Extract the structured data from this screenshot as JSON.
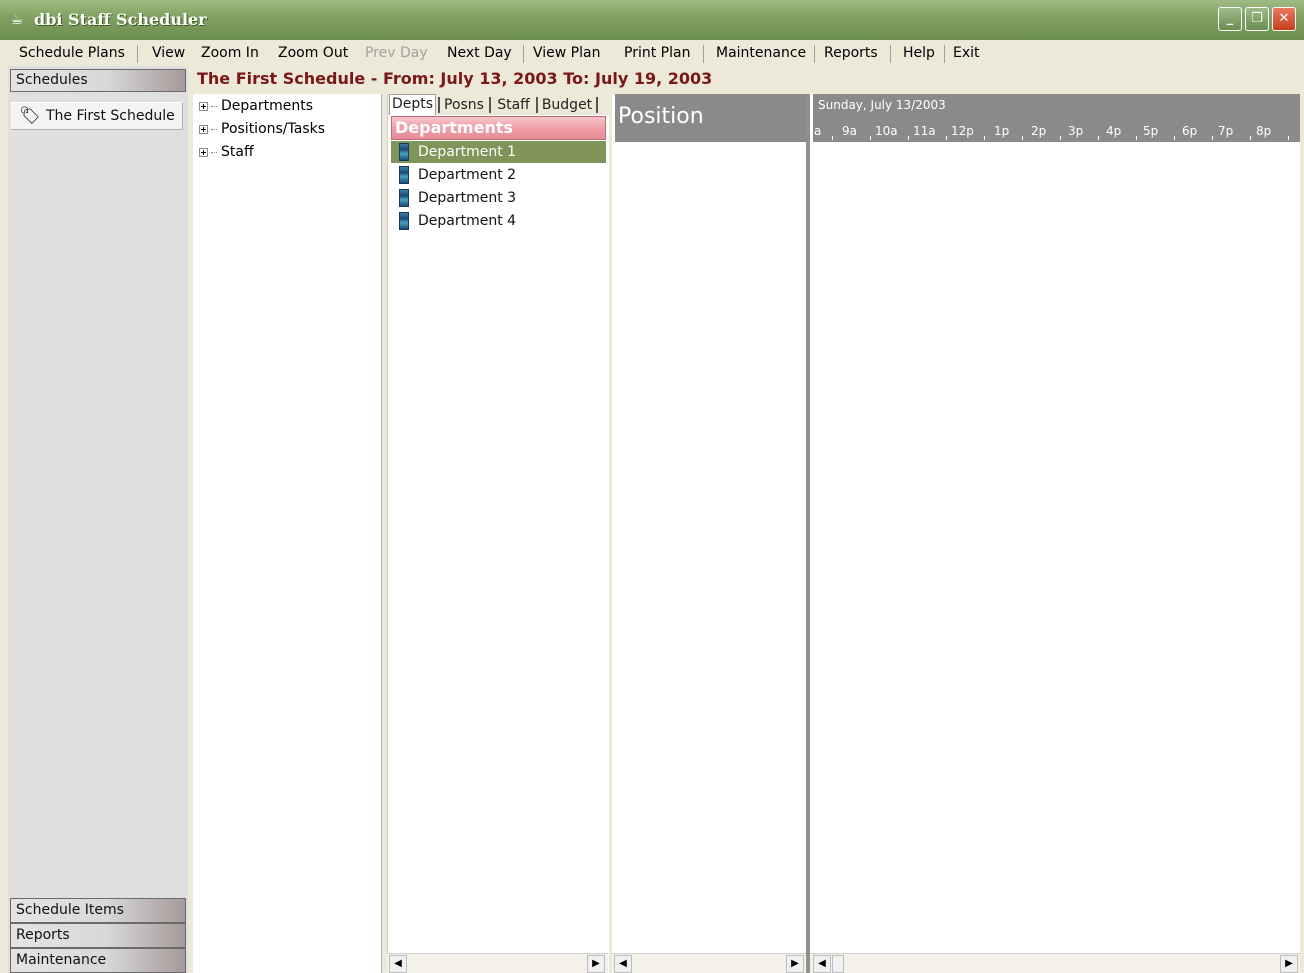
{
  "window": {
    "title": "dbi Staff Scheduler",
    "icon": "coffee-cup-icon",
    "controls": [
      "_",
      "❐",
      "✕"
    ]
  },
  "menu": {
    "items": [
      {
        "label": "Schedule Plans",
        "enabled": true
      },
      {
        "label": "View",
        "enabled": true
      },
      {
        "label": "Zoom In",
        "enabled": true
      },
      {
        "label": "Zoom Out",
        "enabled": true
      },
      {
        "label": "Prev Day",
        "enabled": false
      },
      {
        "label": "Next Day",
        "enabled": true
      },
      {
        "label": "View Plan",
        "enabled": true
      },
      {
        "label": "Print Plan",
        "enabled": true
      },
      {
        "label": "Maintenance",
        "enabled": true
      },
      {
        "label": "Reports",
        "enabled": true
      },
      {
        "label": "Help",
        "enabled": true
      },
      {
        "label": "Exit",
        "enabled": true
      }
    ]
  },
  "leftnav": {
    "header": "Schedules",
    "schedule_item": "The First Schedule",
    "bottom": [
      "Schedule Items",
      "Reports",
      "Maintenance"
    ]
  },
  "heading": "The First Schedule - From: July 13, 2003 To: July 19, 2003",
  "tree": {
    "items": [
      "Departments",
      "Positions/Tasks",
      "Staff"
    ]
  },
  "tabs": [
    "Depts",
    "Posns",
    "Staff",
    "Budget"
  ],
  "departments": {
    "header": "Departments",
    "items": [
      "Department 1",
      "Department 2",
      "Department 3",
      "Department 4"
    ],
    "selected_index": 0
  },
  "position": {
    "header": "Position"
  },
  "timeline": {
    "date": "Sunday, July 13/2003",
    "hours": [
      "a",
      "9a",
      "10a",
      "11a",
      "12p",
      "1p",
      "2p",
      "3p",
      "4p",
      "5p",
      "6p",
      "7p",
      "8p"
    ]
  },
  "scroll": {
    "left": "◀",
    "right": "▶"
  },
  "colors": {
    "title_bar": "#7fa060",
    "heading": "#7a1818",
    "dept_header": "#ee9aa4",
    "selected_row": "#7f955a",
    "panel_header": "#8a8a8a"
  }
}
